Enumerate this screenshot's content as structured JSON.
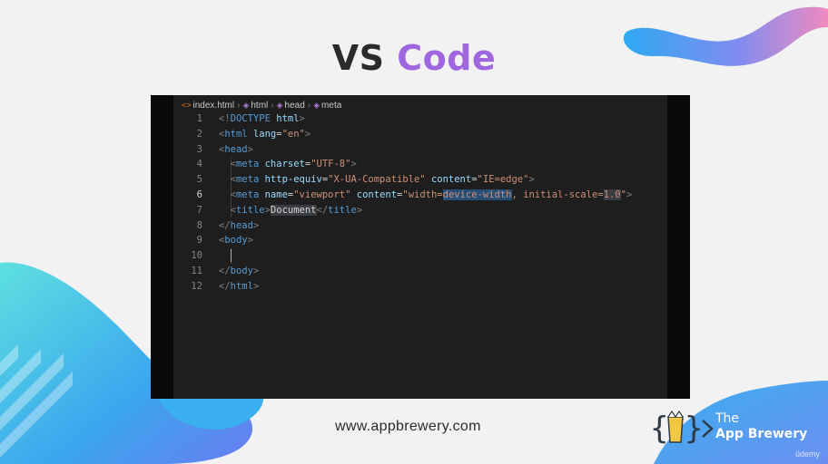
{
  "slide": {
    "title_part1": "VS",
    "title_part2": "Code",
    "footer_url": "www.appbrewery.com",
    "brand_the": "The",
    "brand_name": "App Brewery",
    "watermark": "ûdemy"
  },
  "colors": {
    "background": "#f2f2f2",
    "title_dark": "#2b2b2b",
    "title_accent": "#a066e0",
    "editor_bg": "#1e1e1e",
    "wave_blue": "#3ab0f0",
    "wave_purple": "#a07af0",
    "logo_yellow": "#f2c744",
    "logo_dark": "#2e3a46"
  },
  "editor": {
    "breadcrumb": [
      {
        "icon": "html-file-icon",
        "label": "index.html"
      },
      {
        "icon": "html-tag-icon",
        "label": "html"
      },
      {
        "icon": "html-tag-icon",
        "label": "head"
      },
      {
        "icon": "html-tag-icon",
        "label": "meta"
      }
    ],
    "active_line": 6,
    "lines": [
      {
        "number": "1"
      },
      {
        "number": "2"
      },
      {
        "number": "3"
      },
      {
        "number": "4"
      },
      {
        "number": "5"
      },
      {
        "number": "6"
      },
      {
        "number": "7"
      },
      {
        "number": "8"
      },
      {
        "number": "9"
      },
      {
        "number": "10"
      },
      {
        "number": "11"
      },
      {
        "number": "12"
      }
    ],
    "tokens": {
      "l1_lt": "<!",
      "l1_doctype": "DOCTYPE",
      "l1_html": "html",
      "l1_gt": ">",
      "l2_lt": "<",
      "l2_tag": "html",
      "l2_attr": "lang",
      "l2_eq": "=",
      "l2_val": "\"en\"",
      "l2_gt": ">",
      "l3_lt": "<",
      "l3_tag": "head",
      "l3_gt": ">",
      "l4_lt": "<",
      "l4_tag": "meta",
      "l4_attr": "charset",
      "l4_eq": "=",
      "l4_val": "\"UTF-8\"",
      "l4_gt": ">",
      "l5_lt": "<",
      "l5_tag": "meta",
      "l5_attr1": "http-equiv",
      "l5_eq1": "=",
      "l5_val1": "\"X-UA-Compatible\"",
      "l5_attr2": "content",
      "l5_eq2": "=",
      "l5_val2": "\"IE=edge\"",
      "l5_gt": ">",
      "l6_lt": "<",
      "l6_tag": "meta",
      "l6_attr1": "name",
      "l6_eq1": "=",
      "l6_val1": "\"viewport\"",
      "l6_attr2": "content",
      "l6_eq2": "=",
      "l6_val2a": "\"width=",
      "l6_val2sel": "device-width",
      "l6_val2b": ", initial-scale=",
      "l6_val2c": "1.0",
      "l6_val2d": "\"",
      "l6_gt": ">",
      "l7_lt": "<",
      "l7_tag": "title",
      "l7_gt": ">",
      "l7_text": "Document",
      "l7_lt2": "</",
      "l7_tag2": "title",
      "l7_gt2": ">",
      "l8_lt": "</",
      "l8_tag": "head",
      "l8_gt": ">",
      "l9_lt": "<",
      "l9_tag": "body",
      "l9_gt": ">",
      "l11_lt": "</",
      "l11_tag": "body",
      "l11_gt": ">",
      "l12_lt": "</",
      "l12_tag": "html",
      "l12_gt": ">"
    }
  }
}
